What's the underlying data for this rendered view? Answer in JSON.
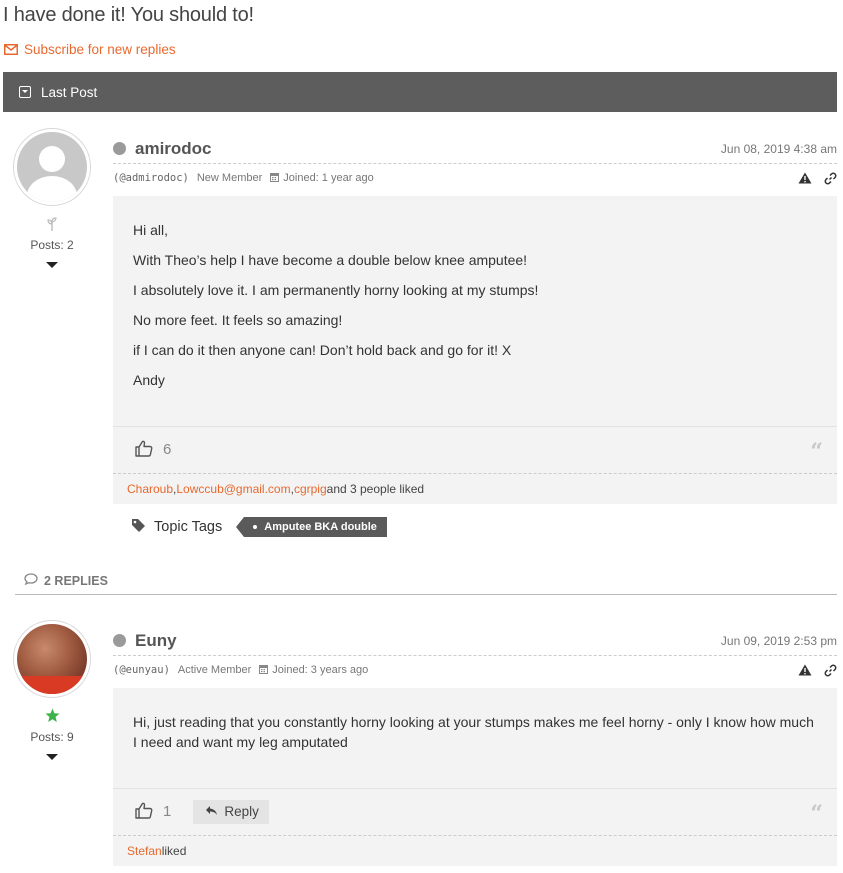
{
  "topic": {
    "title": "I have done it! You should to!",
    "subscribe_label": "Subscribe for new replies",
    "last_post_label": "Last Post"
  },
  "colors": {
    "accent": "#e8692e",
    "bar": "#5d5d5d",
    "online_rank": "#3cb44b"
  },
  "first_post": {
    "author": "amirodoc",
    "handle": "(@admirodoc)",
    "role": "New Member",
    "joined": "Joined: 1 year ago",
    "date": "Jun 08, 2019 4:38 am",
    "posts_label": "Posts: 2",
    "avatar": "default-user-avatar",
    "paragraphs": [
      "Hi all,",
      "With Theo’s help I have become a double below knee amputee!",
      "I absolutely love it. I am permanently horny looking at my stumps!",
      "No more feet. It feels so amazing!",
      "if I can do it then anyone can! Don’t hold back and go for it! X",
      "Andy"
    ],
    "like_count": "6",
    "liked_by": {
      "names": [
        "Charoub",
        "Lowccub@gmail.com",
        "cgrpig"
      ],
      "sep1": ", ",
      "sep2": ", ",
      "suffix": " and 3 people liked"
    },
    "tags_label": "Topic Tags",
    "tags": [
      "Amputee BKA double"
    ]
  },
  "replies": {
    "count_label": "2 REPLIES"
  },
  "second_post": {
    "author": "Euny",
    "handle": "(@eunyau)",
    "role": "Active Member",
    "joined": "Joined: 3 years ago",
    "date": "Jun 09, 2019 2:53 pm",
    "posts_label": "Posts: 9",
    "avatar": "user-photo-avatar",
    "paragraphs": [
      "Hi, just reading that you constantly horny looking at your stumps makes me feel horny - only I know how much I need and want my leg amputated"
    ],
    "like_count": "1",
    "reply_label": "Reply",
    "liked_by": {
      "names": [
        "Stefan"
      ],
      "suffix": " liked"
    }
  },
  "icons": {
    "subscribe": "envelope-icon",
    "collapse": "collapse-square-icon",
    "status": "status-dot-icon",
    "joined": "calendar-icon",
    "report": "warning-icon",
    "permalink": "link-icon",
    "like": "thumbs-up-icon",
    "quote": "quote-icon",
    "reply": "reply-arrow-icon",
    "tag": "tag-icon",
    "replies": "comment-icon",
    "rank_new": "sprout-icon",
    "rank_active": "star-icon",
    "toggle": "caret-down-icon"
  }
}
